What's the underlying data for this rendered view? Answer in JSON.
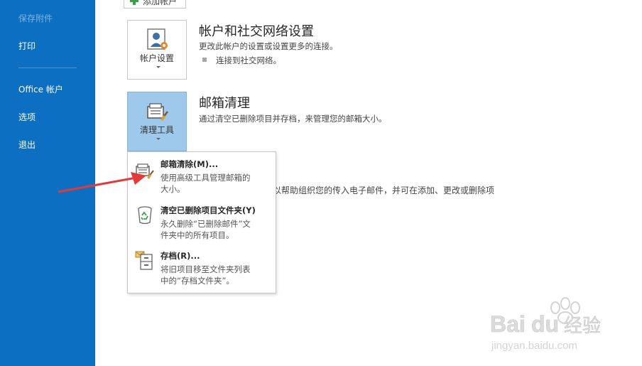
{
  "sidebar": {
    "items": [
      {
        "label": "保存附件"
      },
      {
        "label": "打印"
      },
      {
        "label": "Office 帐户"
      },
      {
        "label": "选项"
      },
      {
        "label": "退出"
      }
    ]
  },
  "toolbar": {
    "add_account_label": "添加帐户"
  },
  "account_section": {
    "button_label": "帐户设置",
    "title": "帐户和社交网络设置",
    "description": "更改此帐户的设置或设置更多的连接。",
    "link": "连接到社交网络。"
  },
  "cleanup_section": {
    "button_label": "清理工具",
    "title": "邮箱清理",
    "description": "通过清空已删除项目并存档，来管理您的邮箱大小。"
  },
  "rules_section": {
    "description_fragment": "以帮助组织您的传入电子邮件，并可在添加、更改或删除项"
  },
  "dropdown": {
    "items": [
      {
        "title": "邮箱清除(M)...",
        "description": "使用高级工具管理邮箱的\n大小。",
        "icon": "mailbox-cleanup-icon"
      },
      {
        "title": "清空已删除项目文件夹(Y)",
        "description": "永久删除“已删除邮件”文\n件夹中的所有项目。",
        "icon": "recycle-bin-icon"
      },
      {
        "title": "存档(R)...",
        "description": "将旧项目移至文件夹列表\n中的“存档文件夹”。",
        "icon": "archive-cabinet-icon"
      }
    ]
  },
  "watermark": {
    "brand": "Bai",
    "brand2": "du",
    "cn": "经验",
    "url": "jingyan.baidu.com"
  },
  "colors": {
    "sidebar_bg": "#0d6fc2",
    "active_button_bg": "#9ec9eb",
    "arrow": "#e03a3a"
  }
}
